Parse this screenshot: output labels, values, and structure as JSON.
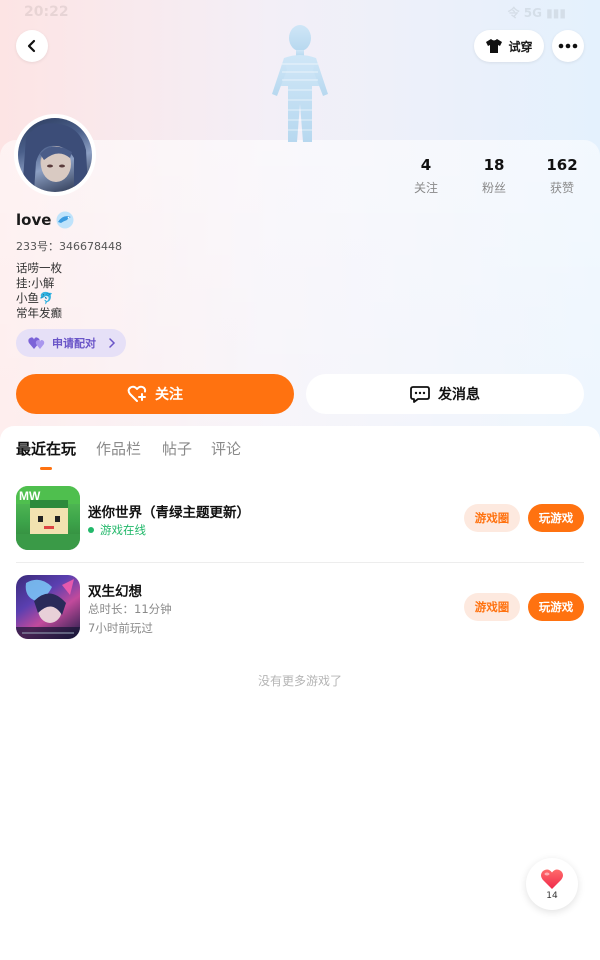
{
  "status_bar": {
    "time": "20:22",
    "right": "令 5G ▮▮▮"
  },
  "header": {
    "try_on_label": "试穿"
  },
  "profile": {
    "username": "love",
    "uid": "233号：346678448",
    "bio": [
      "话唠一枚",
      "挂:小解",
      "小鱼🐬",
      "常年发癫"
    ],
    "pair_label": "申请配对",
    "stats": [
      {
        "value": "4",
        "label": "关注"
      },
      {
        "value": "18",
        "label": "粉丝"
      },
      {
        "value": "162",
        "label": "获赞"
      }
    ]
  },
  "actions": {
    "follow_label": "关注",
    "message_label": "发消息"
  },
  "tabs": [
    {
      "label": "最近在玩",
      "active": true
    },
    {
      "label": "作品栏",
      "active": false
    },
    {
      "label": "帖子",
      "active": false
    },
    {
      "label": "评论",
      "active": false
    }
  ],
  "games": [
    {
      "title": "迷你世界（青绿主题更新）",
      "status": "游戏在线",
      "circle_label": "游戏圈",
      "play_label": "玩游戏"
    },
    {
      "title": "双生幻想",
      "total_time": "总时长：11分钟",
      "last_played": "7小时前玩过",
      "circle_label": "游戏圈",
      "play_label": "玩游戏"
    }
  ],
  "footer_note": "没有更多游戏了",
  "like": {
    "count": "14"
  },
  "colors": {
    "accent": "#ff7210",
    "online": "#22b86a",
    "pair": "#6a55c8"
  }
}
